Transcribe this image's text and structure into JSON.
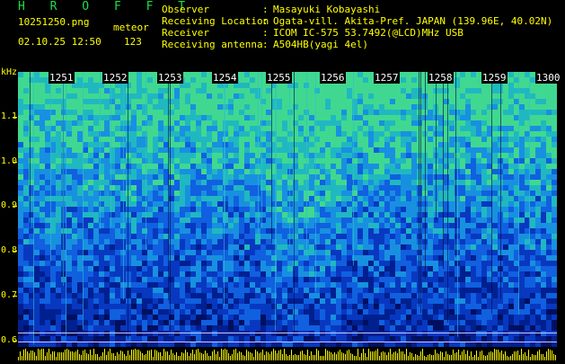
{
  "header": {
    "brand": "H R O F F T",
    "filename": "10251250.png",
    "meteor_label": "meteor",
    "timestamp": "02.10.25 12:50",
    "meteor_count": "123"
  },
  "info": {
    "observer_key": "Observer",
    "observer_val": "Masayuki Kobayashi",
    "location_key": "Receiving Location",
    "location_val": "Ogata-vill. Akita-Pref. JAPAN (139.96E, 40.02N)",
    "receiver_key": "Receiver",
    "receiver_val": "ICOM IC-575 53.7492(@LCD)MHz USB",
    "antenna_key": "Receiving antenna",
    "antenna_val": "A504HB(yagi 4el)",
    "sep": ":"
  },
  "yaxis": {
    "unit": "kHz",
    "labels": [
      "1.1",
      "1.0",
      "0.9",
      "0.8",
      "0.7",
      "0.6"
    ]
  },
  "xaxis": {
    "minutes": [
      "1251",
      "1252",
      "1253",
      "1254",
      "1255",
      "1256",
      "1257",
      "1258",
      "1259",
      "1300"
    ]
  },
  "colors": {
    "background": "#000000",
    "text": "#ffff00",
    "brand": "#19e04a",
    "noise_low": "#001a80",
    "noise_mid": "#0a50d0",
    "noise_high": "#30c8a0"
  }
}
